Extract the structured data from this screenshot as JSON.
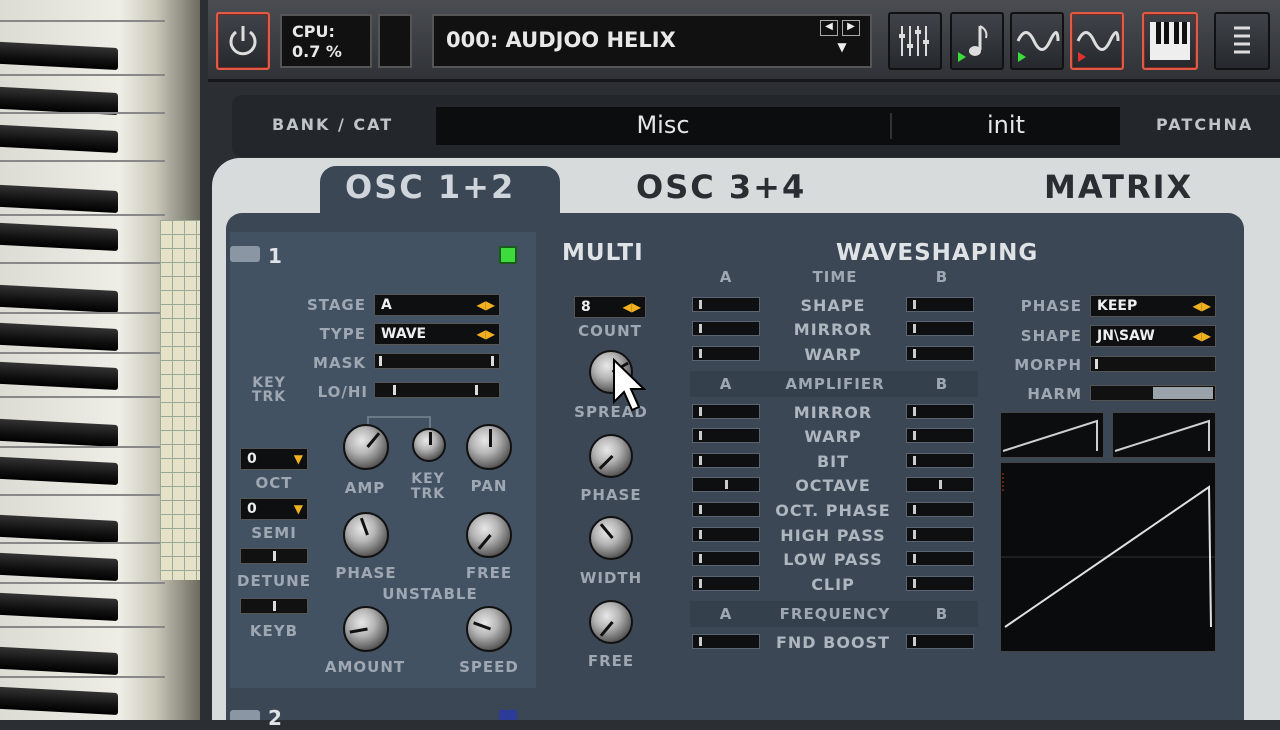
{
  "topbar": {
    "cpu_label": "CPU:",
    "cpu_value": "0.7 %",
    "preset": "000: AUDJOO HELIX"
  },
  "bank": {
    "label": "BANK / CAT",
    "category": "Misc",
    "value": "init",
    "patch_label": "PATCHNA"
  },
  "tabs": [
    "OSC 1+2",
    "OSC 3+4",
    "MATRIX"
  ],
  "osc1": {
    "number": "1",
    "stage_label": "STAGE",
    "stage_value": "A",
    "type_label": "TYPE",
    "type_value": "WAVE",
    "mask_label": "MASK",
    "keytrk_label": "KEY TRK",
    "lohi_label": "LO/HI",
    "oct_label": "OCT",
    "oct_value": "0",
    "semi_label": "SEMI",
    "semi_value": "0",
    "detune_label": "DETUNE",
    "keyb_label": "KEYB",
    "amp_label": "AMP",
    "keytrk_knob_label": "KEY TRK",
    "pan_label": "PAN",
    "phase_label": "PHASE",
    "free_label": "FREE",
    "unstable_label": "UNSTABLE",
    "amount_label": "AMOUNT",
    "speed_label": "SPEED",
    "osc2_number": "2"
  },
  "multi": {
    "title": "MULTI",
    "count_value": "8",
    "count_label": "COUNT",
    "spread_label": "SPREAD",
    "phase_label": "PHASE",
    "width_label": "WIDTH",
    "free_label": "FREE"
  },
  "waveshaping": {
    "title": "WAVESHAPING",
    "a": "A",
    "b": "B",
    "time_label": "TIME",
    "time_rows": [
      "SHAPE",
      "MIRROR",
      "WARP"
    ],
    "amp_label": "AMPLIFIER",
    "amp_rows": [
      "MIRROR",
      "WARP",
      "BIT",
      "OCTAVE",
      "OCT. PHASE",
      "HIGH PASS",
      "LOW PASS",
      "CLIP"
    ],
    "freq_label": "FREQUENCY",
    "freq_rows": [
      "FND BOOST"
    ],
    "phase_label": "PHASE",
    "phase_value": "KEEP",
    "shape_label": "SHAPE",
    "shape_value": "JN\\SAW",
    "morph_label": "MORPH",
    "harm_label": "HARM",
    "harm_level": 0.5
  },
  "colors": {
    "led": "#3cdc3c",
    "accent_red": "#e05a45",
    "arrow": "#f0b020"
  }
}
